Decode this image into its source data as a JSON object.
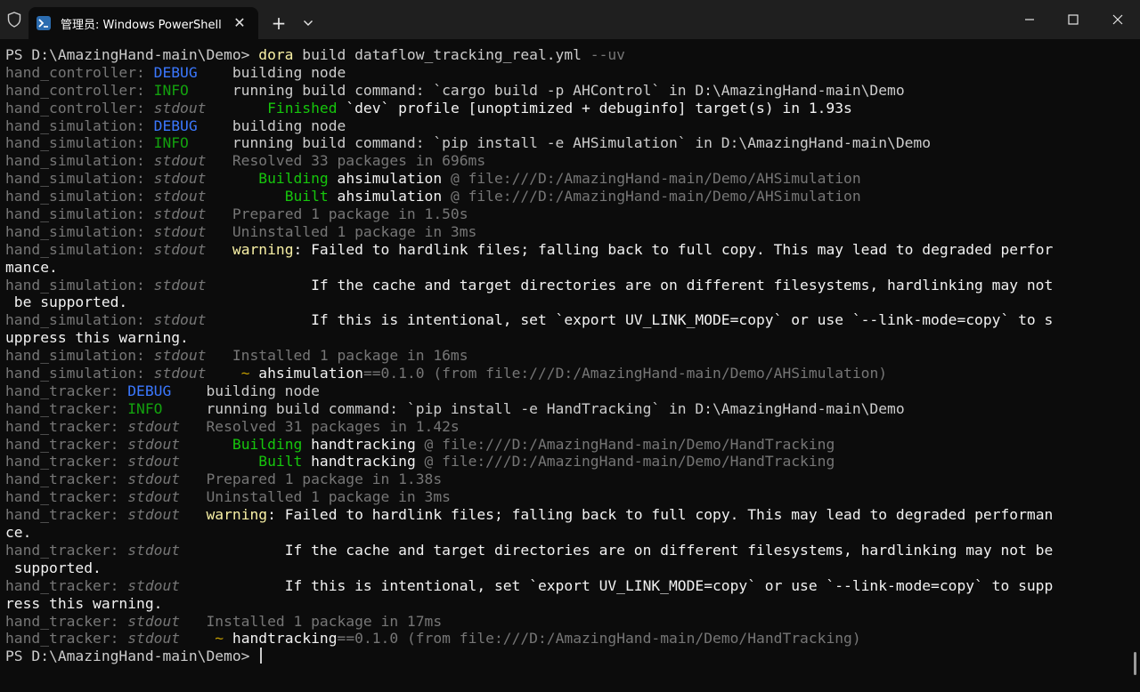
{
  "window": {
    "tab_title": "管理员: Windows PowerShell",
    "tab_icon": "powershell-icon",
    "shield_icon": "shield-icon",
    "new_tab_label": "+",
    "close_tab_label": "✕"
  },
  "colors": {
    "background": "#0c0c0c",
    "titlebar": "#1f1f1f",
    "prompt": "#cccccc",
    "command": "#f9f1a5",
    "debug": "#3b78ff",
    "info": "#13a10e",
    "stdout": "#767676",
    "warning": "#f9f1a5"
  },
  "terminal": {
    "lines": [
      [
        [
          "c-default",
          "PS D:\\AmazingHand-main\\Demo> "
        ],
        [
          "c-cmd",
          "dora"
        ],
        [
          "c-default",
          " build dataflow_tracking_real.yml "
        ],
        [
          "c-gray",
          "--uv"
        ]
      ],
      [
        [
          "c-gray",
          "hand_controller: "
        ],
        [
          "c-blue",
          "DEBUG"
        ],
        [
          "c-default",
          "    building node"
        ]
      ],
      [
        [
          "c-gray",
          "hand_controller: "
        ],
        [
          "c-green",
          "INFO"
        ],
        [
          "c-default",
          "     running build command: `cargo build -p AHControl` in D:\\AmazingHand-main\\Demo"
        ]
      ],
      [
        [
          "c-gray",
          "hand_controller: "
        ],
        [
          "c-gray italic",
          "stdout"
        ],
        [
          "c-default",
          "       "
        ],
        [
          "c-bgreen",
          "Finished"
        ],
        [
          "c-white",
          " `dev` profile [unoptimized + debuginfo] target(s) in 1.93s"
        ]
      ],
      [
        [
          "c-gray",
          "hand_simulation: "
        ],
        [
          "c-blue",
          "DEBUG"
        ],
        [
          "c-default",
          "    building node"
        ]
      ],
      [
        [
          "c-gray",
          "hand_simulation: "
        ],
        [
          "c-green",
          "INFO"
        ],
        [
          "c-default",
          "     running build command: `pip install -e AHSimulation` in D:\\AmazingHand-main\\Demo"
        ]
      ],
      [
        [
          "c-gray",
          "hand_simulation: "
        ],
        [
          "c-gray italic",
          "stdout"
        ],
        [
          "c-gray",
          "   Resolved 33 packages in 696ms"
        ]
      ],
      [
        [
          "c-gray",
          "hand_simulation: "
        ],
        [
          "c-gray italic",
          "stdout"
        ],
        [
          "c-default",
          "      "
        ],
        [
          "c-bgreen",
          "Building"
        ],
        [
          "c-white",
          " ahsimulation"
        ],
        [
          "c-gray",
          " @ file:///D:/AmazingHand-main/Demo/AHSimulation"
        ]
      ],
      [
        [
          "c-gray",
          "hand_simulation: "
        ],
        [
          "c-gray italic",
          "stdout"
        ],
        [
          "c-default",
          "         "
        ],
        [
          "c-bgreen",
          "Built"
        ],
        [
          "c-white",
          " ahsimulation"
        ],
        [
          "c-gray",
          " @ file:///D:/AmazingHand-main/Demo/AHSimulation"
        ]
      ],
      [
        [
          "c-gray",
          "hand_simulation: "
        ],
        [
          "c-gray italic",
          "stdout"
        ],
        [
          "c-gray",
          "   Prepared 1 package in 1.50s"
        ]
      ],
      [
        [
          "c-gray",
          "hand_simulation: "
        ],
        [
          "c-gray italic",
          "stdout"
        ],
        [
          "c-gray",
          "   Uninstalled 1 package in 3ms"
        ]
      ],
      [
        [
          "c-gray",
          "hand_simulation: "
        ],
        [
          "c-gray italic",
          "stdout"
        ],
        [
          "c-default",
          "   "
        ],
        [
          "c-yellow",
          "warning"
        ],
        [
          "c-white",
          ": Failed to hardlink files; falling back to full copy. This may lead to degraded perfor"
        ]
      ],
      [
        [
          "c-white",
          "mance."
        ]
      ],
      [
        [
          "c-gray",
          "hand_simulation: "
        ],
        [
          "c-gray italic",
          "stdout"
        ],
        [
          "c-white",
          "            If the cache and target directories are on different filesystems, hardlinking may not"
        ]
      ],
      [
        [
          "c-white",
          " be supported."
        ]
      ],
      [
        [
          "c-gray",
          "hand_simulation: "
        ],
        [
          "c-gray italic",
          "stdout"
        ],
        [
          "c-white",
          "            If this is intentional, set `export UV_LINK_MODE=copy` or use `--link-mode=copy` to s"
        ]
      ],
      [
        [
          "c-white",
          "uppress this warning."
        ]
      ],
      [
        [
          "c-gray",
          "hand_simulation: "
        ],
        [
          "c-gray italic",
          "stdout"
        ],
        [
          "c-gray",
          "   Installed 1 package in 16ms"
        ]
      ],
      [
        [
          "c-gray",
          "hand_simulation: "
        ],
        [
          "c-gray italic",
          "stdout"
        ],
        [
          "c-default",
          "    "
        ],
        [
          "c-orange",
          "~"
        ],
        [
          "c-white",
          " ahsimulation"
        ],
        [
          "c-gray",
          "==0.1.0 (from file:///D:/AmazingHand-main/Demo/AHSimulation)"
        ]
      ],
      [
        [
          "c-gray",
          "hand_tracker: "
        ],
        [
          "c-blue",
          "DEBUG"
        ],
        [
          "c-default",
          "    building node"
        ]
      ],
      [
        [
          "c-gray",
          "hand_tracker: "
        ],
        [
          "c-green",
          "INFO"
        ],
        [
          "c-default",
          "     running build command: `pip install -e HandTracking` in D:\\AmazingHand-main\\Demo"
        ]
      ],
      [
        [
          "c-gray",
          "hand_tracker: "
        ],
        [
          "c-gray italic",
          "stdout"
        ],
        [
          "c-gray",
          "   Resolved 31 packages in 1.42s"
        ]
      ],
      [
        [
          "c-gray",
          "hand_tracker: "
        ],
        [
          "c-gray italic",
          "stdout"
        ],
        [
          "c-default",
          "      "
        ],
        [
          "c-bgreen",
          "Building"
        ],
        [
          "c-white",
          " handtracking"
        ],
        [
          "c-gray",
          " @ file:///D:/AmazingHand-main/Demo/HandTracking"
        ]
      ],
      [
        [
          "c-gray",
          "hand_tracker: "
        ],
        [
          "c-gray italic",
          "stdout"
        ],
        [
          "c-default",
          "         "
        ],
        [
          "c-bgreen",
          "Built"
        ],
        [
          "c-white",
          " handtracking"
        ],
        [
          "c-gray",
          " @ file:///D:/AmazingHand-main/Demo/HandTracking"
        ]
      ],
      [
        [
          "c-gray",
          "hand_tracker: "
        ],
        [
          "c-gray italic",
          "stdout"
        ],
        [
          "c-gray",
          "   Prepared 1 package in 1.38s"
        ]
      ],
      [
        [
          "c-gray",
          "hand_tracker: "
        ],
        [
          "c-gray italic",
          "stdout"
        ],
        [
          "c-gray",
          "   Uninstalled 1 package in 3ms"
        ]
      ],
      [
        [
          "c-gray",
          "hand_tracker: "
        ],
        [
          "c-gray italic",
          "stdout"
        ],
        [
          "c-default",
          "   "
        ],
        [
          "c-yellow",
          "warning"
        ],
        [
          "c-white",
          ": Failed to hardlink files; falling back to full copy. This may lead to degraded performan"
        ]
      ],
      [
        [
          "c-white",
          "ce."
        ]
      ],
      [
        [
          "c-gray",
          "hand_tracker: "
        ],
        [
          "c-gray italic",
          "stdout"
        ],
        [
          "c-white",
          "            If the cache and target directories are on different filesystems, hardlinking may not be"
        ]
      ],
      [
        [
          "c-white",
          " supported."
        ]
      ],
      [
        [
          "c-gray",
          "hand_tracker: "
        ],
        [
          "c-gray italic",
          "stdout"
        ],
        [
          "c-white",
          "            If this is intentional, set `export UV_LINK_MODE=copy` or use `--link-mode=copy` to supp"
        ]
      ],
      [
        [
          "c-white",
          "ress this warning."
        ]
      ],
      [
        [
          "c-gray",
          "hand_tracker: "
        ],
        [
          "c-gray italic",
          "stdout"
        ],
        [
          "c-gray",
          "   Installed 1 package in 17ms"
        ]
      ],
      [
        [
          "c-gray",
          "hand_tracker: "
        ],
        [
          "c-gray italic",
          "stdout"
        ],
        [
          "c-default",
          "    "
        ],
        [
          "c-orange",
          "~"
        ],
        [
          "c-white",
          " handtracking"
        ],
        [
          "c-gray",
          "==0.1.0 (from file:///D:/AmazingHand-main/Demo/HandTracking)"
        ]
      ],
      [
        [
          "c-default",
          "PS D:\\AmazingHand-main\\Demo> "
        ]
      ]
    ]
  }
}
